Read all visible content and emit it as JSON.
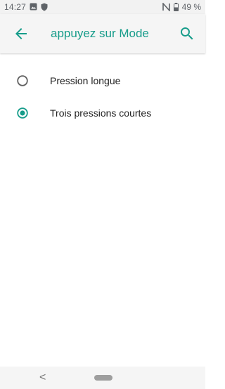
{
  "status_bar": {
    "time": "14:27",
    "battery": "49 %",
    "icons": [
      "image-icon",
      "shield-icon",
      "nfc-icon",
      "battery-icon"
    ]
  },
  "toolbar": {
    "title": "appuyez sur Mode",
    "back_icon": "arrow-left-icon",
    "search_icon": "search-icon",
    "accent_color": "#169c8a"
  },
  "options": [
    {
      "label": "Pression longue",
      "selected": false
    },
    {
      "label": "Trois pressions courtes",
      "selected": true
    }
  ],
  "navigation": {
    "back_glyph": "<",
    "icons": [
      "nav-back-icon",
      "home-pill-icon"
    ]
  }
}
